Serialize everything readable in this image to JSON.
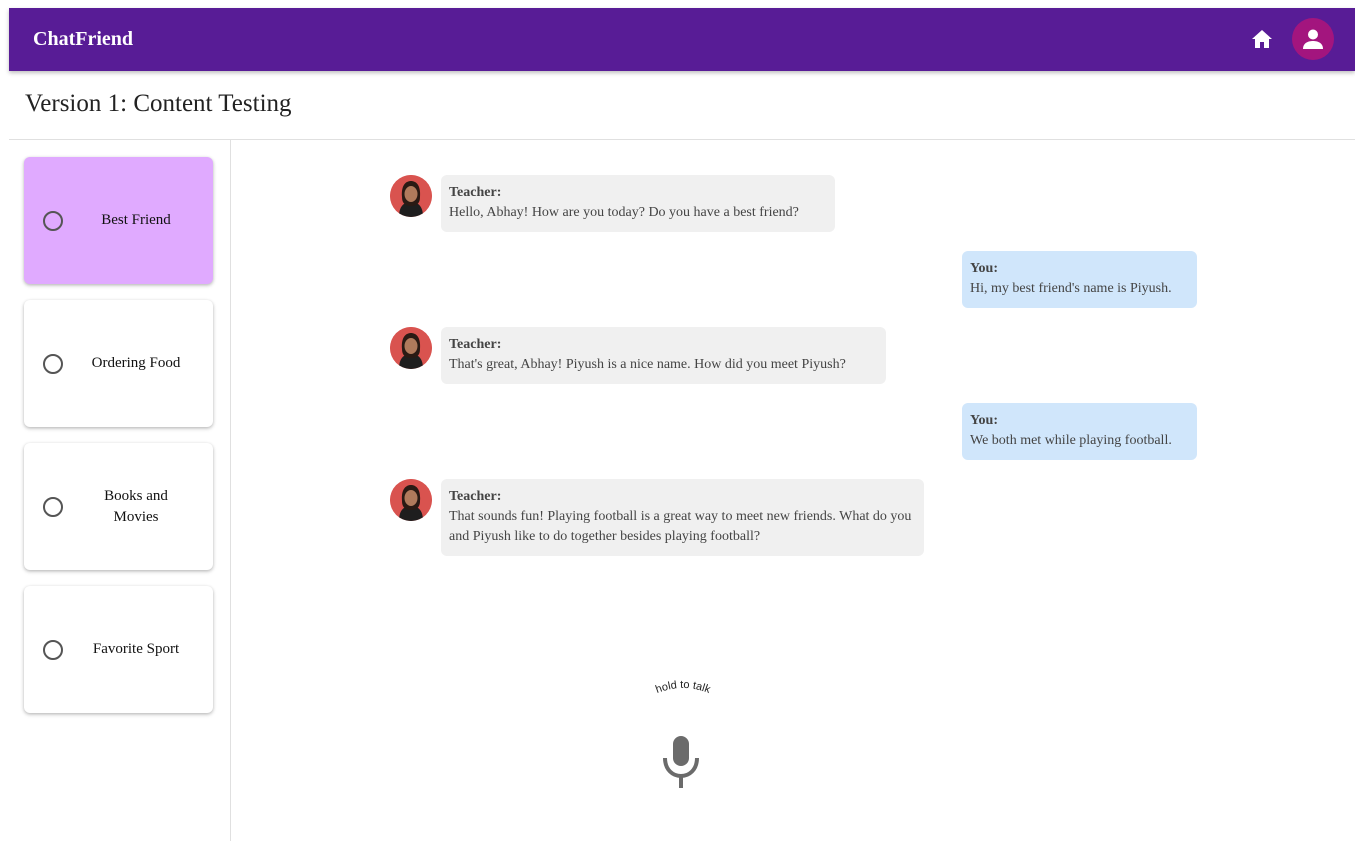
{
  "app": {
    "title": "ChatFriend"
  },
  "colors": {
    "appbar": "#581c96",
    "avatar_bg": "#a3157e",
    "selected_topic": "#e0aaff",
    "teacher_bubble": "#f0f0f0",
    "you_bubble": "#d0e6fb"
  },
  "header_icons": {
    "home": "home-icon",
    "account": "account-icon"
  },
  "page": {
    "title": "Version 1: Content Testing"
  },
  "topics": [
    {
      "label": "Best Friend",
      "selected": true
    },
    {
      "label": "Ordering Food",
      "selected": false
    },
    {
      "label": "Books and Movies",
      "selected": false
    },
    {
      "label": "Favorite Sport",
      "selected": false
    }
  ],
  "messages": [
    {
      "role": "teacher",
      "speaker": "Teacher:",
      "text": "Hello, Abhay! How are you today? Do you have a best friend?"
    },
    {
      "role": "you",
      "speaker": "You:",
      "text": "Hi, my best friend's name is Piyush."
    },
    {
      "role": "teacher",
      "speaker": "Teacher:",
      "text": "That's great, Abhay! Piyush is a nice name. How did you meet Piyush?"
    },
    {
      "role": "you",
      "speaker": "You:",
      "text": "We both met while playing football."
    },
    {
      "role": "teacher",
      "speaker": "Teacher:",
      "text": "That sounds fun! Playing football is a great way to meet new friends. What do you and Piyush like to do together besides playing football?"
    }
  ],
  "voice": {
    "hint": "hold to talk",
    "icon": "microphone-icon"
  }
}
